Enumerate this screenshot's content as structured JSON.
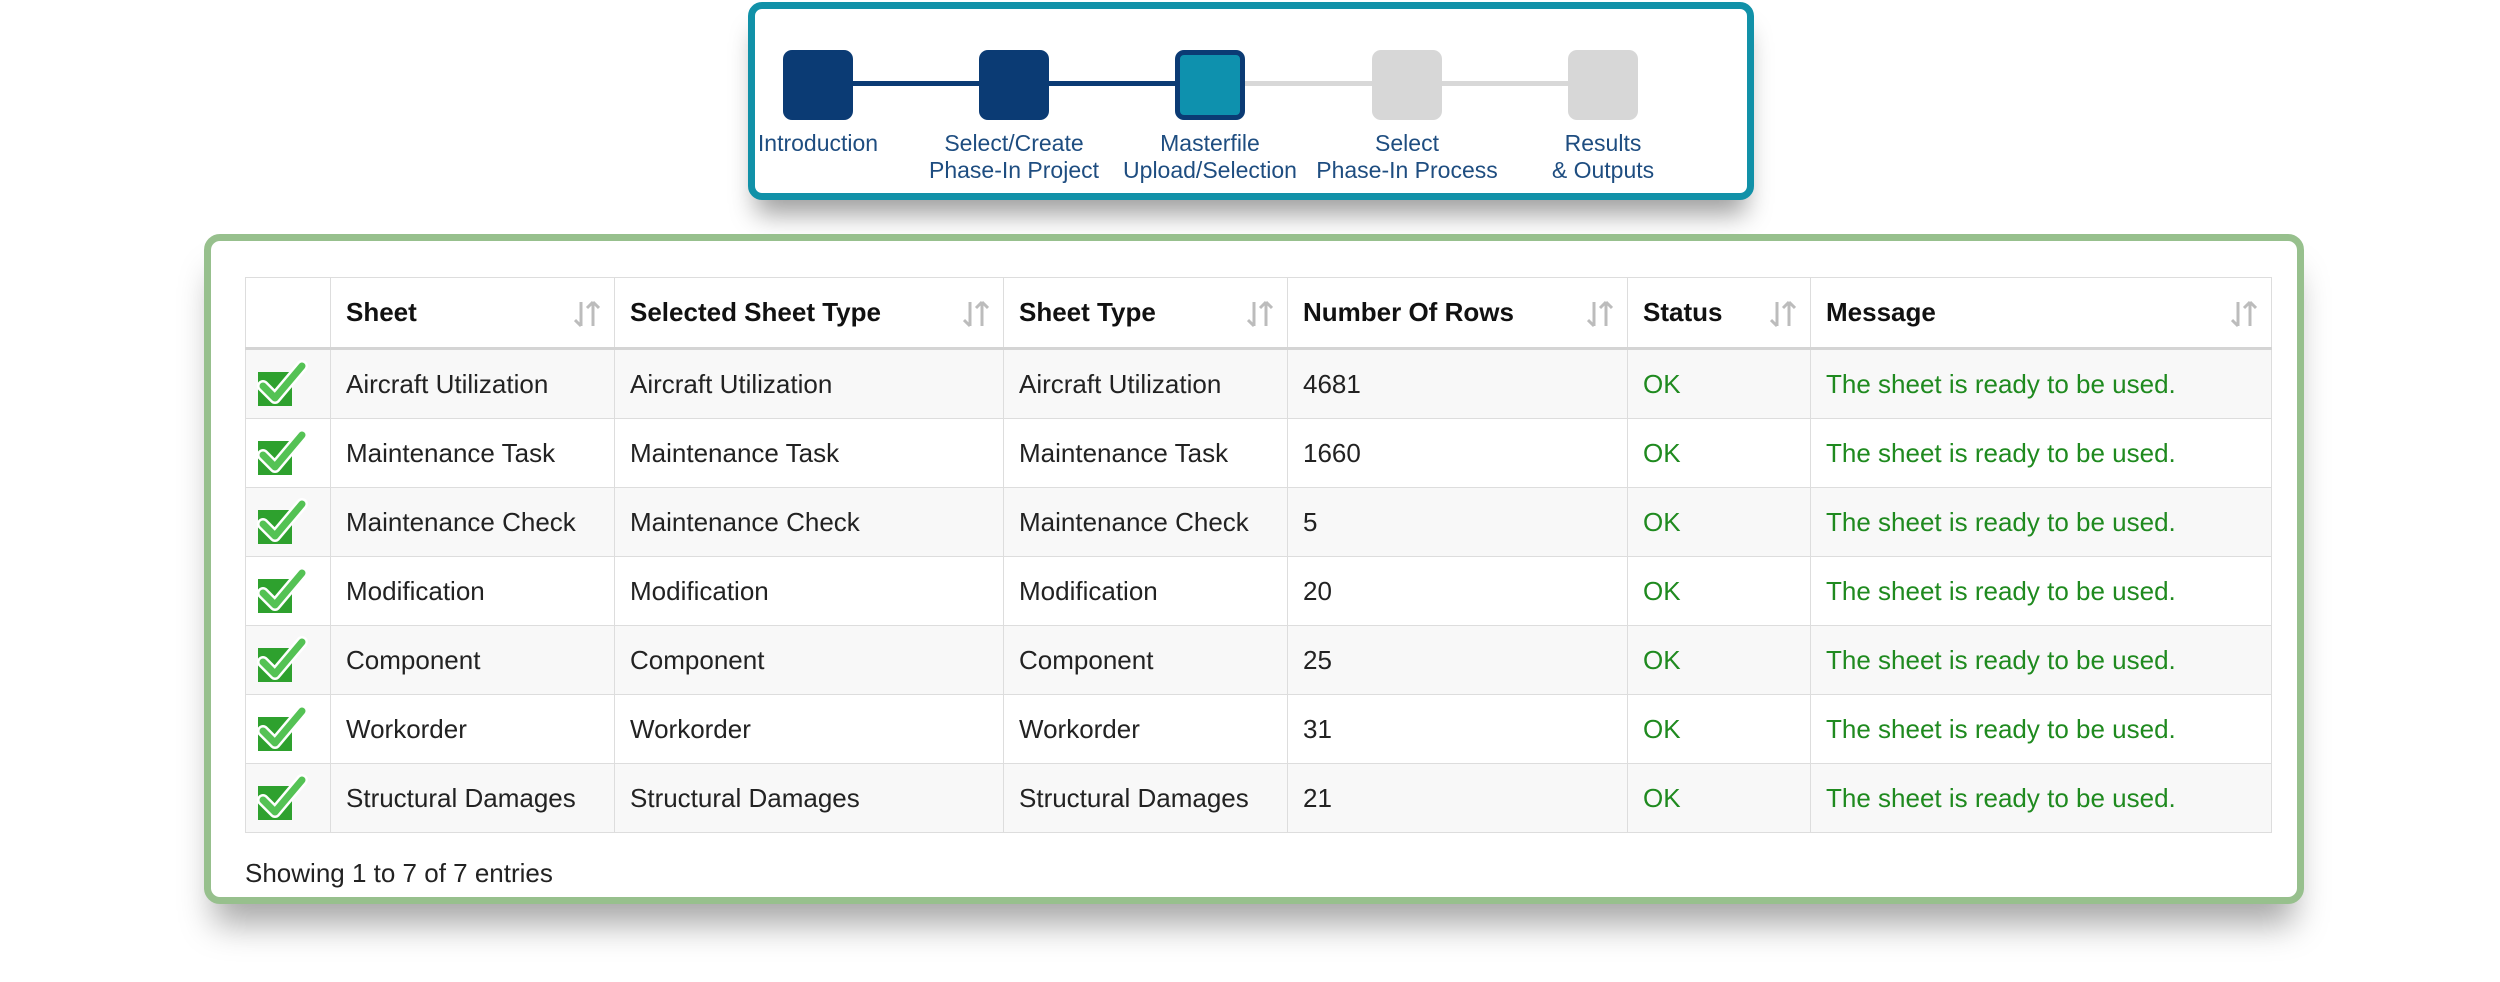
{
  "stepper": {
    "steps": [
      {
        "lines": [
          "Introduction"
        ],
        "state": "done"
      },
      {
        "lines": [
          "Select/Create",
          "Phase-In Project"
        ],
        "state": "done"
      },
      {
        "lines": [
          "Masterfile",
          "Upload/Selection"
        ],
        "state": "current"
      },
      {
        "lines": [
          "Select",
          "Phase-In Process"
        ],
        "state": "todo"
      },
      {
        "lines": [
          "Results",
          "& Outputs"
        ],
        "state": "todo"
      }
    ],
    "colors": {
      "done": "#0b3b74",
      "current": "#0e91ae",
      "todo": "#d7d7d7",
      "frame": "#1191a8"
    }
  },
  "table": {
    "headers": [
      "Sheet",
      "Selected Sheet Type",
      "Sheet Type",
      "Number Of Rows",
      "Status",
      "Message"
    ],
    "rows": [
      {
        "sheet": "Aircraft Utilization",
        "selected_type": "Aircraft Utilization",
        "sheet_type": "Aircraft Utilization",
        "rows": "4681",
        "status": "OK",
        "message": "The sheet is ready to be used."
      },
      {
        "sheet": "Maintenance Task",
        "selected_type": "Maintenance Task",
        "sheet_type": "Maintenance Task",
        "rows": "1660",
        "status": "OK",
        "message": "The sheet is ready to be used."
      },
      {
        "sheet": "Maintenance Check",
        "selected_type": "Maintenance Check",
        "sheet_type": "Maintenance Check",
        "rows": "5",
        "status": "OK",
        "message": "The sheet is ready to be used."
      },
      {
        "sheet": "Modification",
        "selected_type": "Modification",
        "sheet_type": "Modification",
        "rows": "20",
        "status": "OK",
        "message": "The sheet is ready to be used."
      },
      {
        "sheet": "Component",
        "selected_type": "Component",
        "sheet_type": "Component",
        "rows": "25",
        "status": "OK",
        "message": "The sheet is ready to be used."
      },
      {
        "sheet": "Workorder",
        "selected_type": "Workorder",
        "sheet_type": "Workorder",
        "rows": "31",
        "status": "OK",
        "message": "The sheet is ready to be used."
      },
      {
        "sheet": "Structural Damages",
        "selected_type": "Structural Damages",
        "sheet_type": "Structural Damages",
        "rows": "21",
        "status": "OK",
        "message": "The sheet is ready to be used."
      }
    ],
    "row_icon": "checkmark-icon",
    "info": "Showing 1 to 7 of 7 entries",
    "colors": {
      "status_ok": "#1f8a1f",
      "panel_border": "#97c08d"
    }
  }
}
